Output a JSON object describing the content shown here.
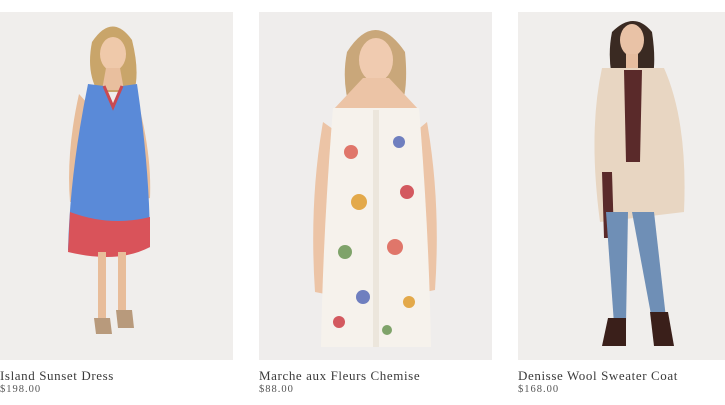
{
  "products": [
    {
      "name": "Island Sunset Dress",
      "price": "$198.00",
      "image": "model-in-blue-red-dress"
    },
    {
      "name": "Marche aux Fleurs Chemise",
      "price": "$88.00",
      "image": "model-in-floral-chemise"
    },
    {
      "name": "Denisse Wool Sweater Coat",
      "price": "$168.00",
      "image": "model-in-beige-sweater-coat"
    }
  ]
}
